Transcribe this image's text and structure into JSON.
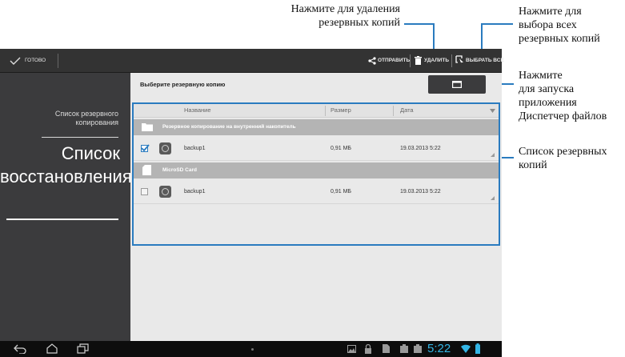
{
  "annotations": {
    "delete": "Нажмите для удаления\nрезервных копий",
    "select_all": "Нажмите для\nвыбора всех\nрезервных копий",
    "file_manager": "Нажмите\nдля запуска\nприложения\nДиспетчер файлов",
    "backup_list": "Список резервных\nкопий"
  },
  "actionbar": {
    "done_label": "ГОТОВО",
    "share_label": "ОТПРАВИТЬ",
    "delete_label": "УДАЛИТЬ",
    "select_all_label": "ВЫБРАТЬ ВСЕ"
  },
  "sidebar": {
    "backup_list_label": "Список резервного копирования",
    "restore_list_label": "Список восстановления"
  },
  "main": {
    "select_prompt": "Выберите резервную копию",
    "columns": {
      "name": "Название",
      "size": "Размер",
      "date": "Дата"
    },
    "groups": [
      {
        "title": "Резервное копирование на внутренний накопитель",
        "items": [
          {
            "name": "backup1",
            "size": "0,91 МБ",
            "date": "19.03.2013 5:22",
            "checked": true
          }
        ]
      },
      {
        "title": "MicroSD Card",
        "items": [
          {
            "name": "backup1",
            "size": "0,91 МБ",
            "date": "19.03.2013 5:22",
            "checked": false
          }
        ]
      }
    ]
  },
  "statusbar": {
    "time": "5:22"
  },
  "colors": {
    "accent": "#2a7bbf",
    "time": "#33b5e5"
  }
}
